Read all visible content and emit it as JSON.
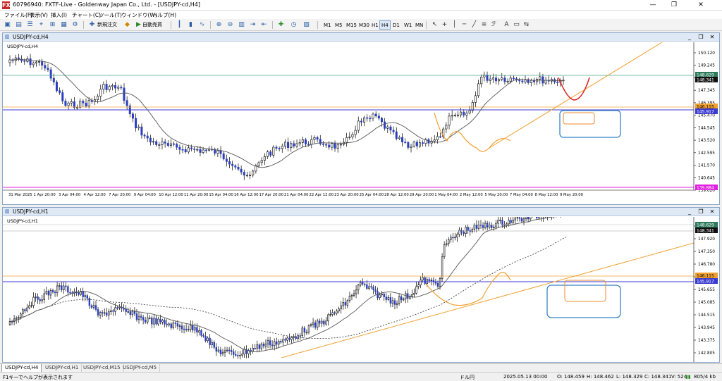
{
  "app": {
    "logo": "FX",
    "title": "60796940: FXTF-Live - Goldenway Japan Co., Ltd. - [USDJPY-cd,H4]",
    "window_controls": {
      "minimize": "—",
      "restore": "❐",
      "close": "✕"
    },
    "inner_controls": {
      "minimize": "_",
      "restore": "❐",
      "close": "✕"
    }
  },
  "menu": [
    "ファイル(F)",
    "表示(V)",
    "挿入(I)",
    "チャート(C)",
    "ツール(T)",
    "ウィンドウ(W)",
    "ヘルプ(H)"
  ],
  "toolbar": {
    "new_order": "新規注文",
    "auto_trade": "自動売買",
    "timeframes": [
      "M1",
      "M5",
      "M15",
      "M30",
      "H1",
      "H4",
      "D1",
      "W1",
      "MN"
    ],
    "active_timeframe": "H4"
  },
  "chart_top": {
    "window_title": "USDJPY-cd,H4",
    "symbol_label": "USDJPY-cd,H4",
    "price_ticks": [
      "150.120",
      "149.245",
      "148.370",
      "147.345",
      "146.395",
      "145.470",
      "144.545",
      "143.520",
      "142.595",
      "141.570",
      "140.645",
      "139.620"
    ],
    "price_tags": {
      "current_green": "148.629",
      "current_black": "148.341",
      "orange_line": "146.115",
      "blue_line": "145.917",
      "magenta_line": "139.884"
    },
    "time_labels": [
      "31 Mar 2025",
      "1 Apr 20:00",
      "3 Apr 04:00",
      "4 Apr 12:00",
      "7 Apr 20:00",
      "9 Apr 04:00",
      "10 Apr 12:00",
      "11 Apr 20:00",
      "15 Apr 04:00",
      "16 Apr 12:00",
      "17 Apr 20:00",
      "21 Apr 04:00",
      "22 Apr 12:00",
      "23 Apr 20:00",
      "25 Apr 04:00",
      "28 Apr 12:00",
      "29 Apr 20:00",
      "1 May 04:00",
      "2 May 12:00",
      "5 May 20:00",
      "7 May 04:00",
      "8 May 12:00",
      "9 May 20:00"
    ]
  },
  "chart_bottom": {
    "window_title": "USDJPY-cd,H1",
    "symbol_label": "USDJPY-cd,H1",
    "price_ticks": [
      "148.490",
      "147.920",
      "147.350",
      "146.780",
      "146.210",
      "145.655",
      "145.085",
      "144.515",
      "143.945",
      "143.375",
      "142.805"
    ],
    "price_tags": {
      "current_green": "148.629",
      "current_black": "148.341",
      "orange_line": "146.115",
      "blue_line": "145.917"
    }
  },
  "tabs": [
    "USDJPY-cd,H4",
    "USDJPY-cd,H1",
    "USDJPY-cd,M15",
    "USDJPY-cd,M5"
  ],
  "status": {
    "help": "F1キーでヘルプが表示されます",
    "profile": "ドル円",
    "datetime": "2025.05.13 00:00",
    "open": "O: 148.459",
    "high": "H: 148.462",
    "low": "L: 148.329",
    "close": "C: 148.341",
    "volume": "V: 524",
    "connection": "805/4 kb"
  },
  "colors": {
    "bull": "#ffffff",
    "bear": "#2a3fbf",
    "ma": "#555555",
    "orange": "#f0a030",
    "blue_line": "#3a3ad0",
    "teal_line": "#4aa58a",
    "magenta": "#e020e0",
    "highlight_blue": "#3b82c8",
    "highlight_orange": "#ef8a2e",
    "projection_red": "#d62020"
  }
}
